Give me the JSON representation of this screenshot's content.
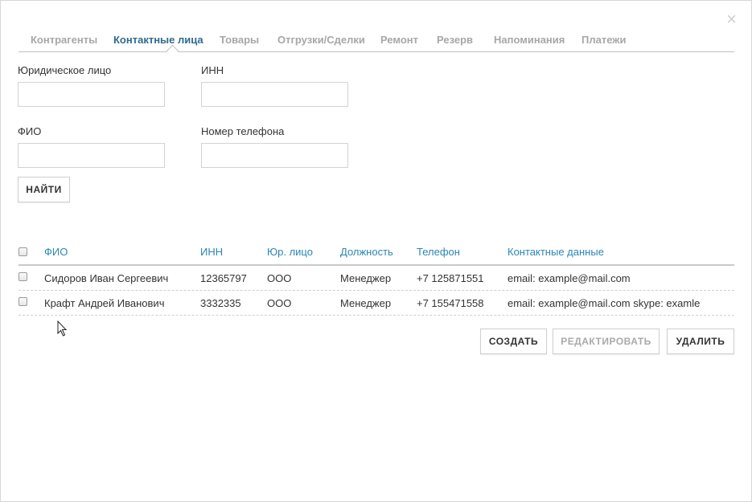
{
  "close_glyph": "×",
  "tabs": [
    {
      "label": "Контрагенты",
      "active": false
    },
    {
      "label": "Контактные лица",
      "active": true
    },
    {
      "label": "Товары",
      "active": false
    },
    {
      "label": "Отгрузки/Сделки",
      "active": false
    },
    {
      "label": "Ремонт",
      "active": false
    },
    {
      "label": "Резерв",
      "active": false
    },
    {
      "label": "Напоминания",
      "active": false
    },
    {
      "label": "Платежи",
      "active": false
    }
  ],
  "form": {
    "legal_entity": {
      "label": "Юридическое лицо",
      "value": ""
    },
    "inn": {
      "label": "ИНН",
      "value": ""
    },
    "fio": {
      "label": "ФИО",
      "value": ""
    },
    "phone": {
      "label": "Номер телефона",
      "value": ""
    },
    "find_button": "НАЙТИ"
  },
  "table": {
    "headers": [
      "ФИО",
      "ИНН",
      "Юр. лицо",
      "Должность",
      "Телефон",
      "Контактные данные"
    ],
    "rows": [
      [
        "Сидоров Иван Сергеевич",
        "12365797",
        "ООО",
        "Менеджер",
        "+7 125871551",
        "email: example@mail.com"
      ],
      [
        "Крафт Андрей Иванович",
        "3332335",
        "ООО",
        "Менеджер",
        "+7 155471558",
        "email: example@mail.com skype: examle"
      ]
    ]
  },
  "actions": {
    "create": "СОЗДАТЬ",
    "edit": "РЕДАКТИРОВАТЬ",
    "delete": "УДАЛИТЬ"
  },
  "colors": {
    "active_tab": "#2c6b8f",
    "inactive_tab": "#a7a7a7",
    "table_header": "#2a86b4",
    "disabled_button": "#a9a9a9"
  }
}
